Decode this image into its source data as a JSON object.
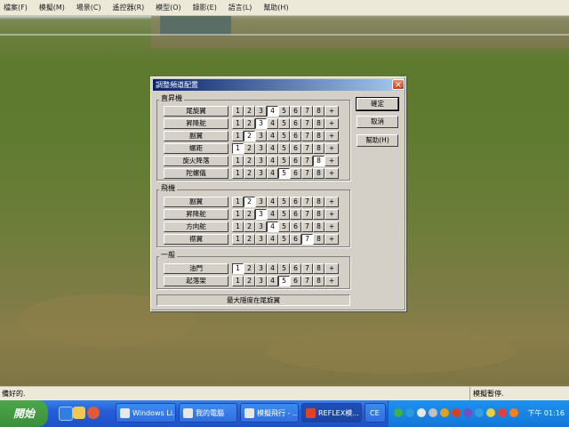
{
  "menu": [
    "檔案(F)",
    "模擬(M)",
    "場景(C)",
    "遙控器(R)",
    "模型(O)",
    "錄影(E)",
    "語言(L)",
    "幫助(H)"
  ],
  "status": {
    "left": "備好的.",
    "right": "模擬暫停."
  },
  "taskbar": {
    "start": "開始",
    "tasks": [
      "Windows Li...",
      "我的電腦",
      "模擬飛行 - ...",
      "REFLEX模...",
      "CE"
    ],
    "clock": "下午 01:16"
  },
  "dialog": {
    "title": "調整頻道配置",
    "close": "×",
    "buttons": {
      "ok": "確定",
      "cancel": "取消",
      "help": "幫助(H)"
    },
    "groups": [
      {
        "label": "直昇機",
        "rows": [
          {
            "name": "尾旋翼",
            "selected": 4
          },
          {
            "name": "昇降舵",
            "selected": 3
          },
          {
            "name": "副翼",
            "selected": 2
          },
          {
            "name": "螺距",
            "selected": 1
          },
          {
            "name": "旋火降落",
            "selected": 8
          },
          {
            "name": "陀螺儀",
            "selected": 5
          }
        ]
      },
      {
        "label": "飛機",
        "rows": [
          {
            "name": "副翼",
            "selected": 2
          },
          {
            "name": "昇降舵",
            "selected": 3
          },
          {
            "name": "方向舵",
            "selected": 4
          },
          {
            "name": "襟翼",
            "selected": 7
          }
        ]
      },
      {
        "label": "一般",
        "rows": [
          {
            "name": "油門",
            "selected": 1,
            "count": 8
          },
          {
            "name": "起落架",
            "selected": 5,
            "count": 8
          }
        ]
      }
    ],
    "numbers": [
      "1",
      "2",
      "3",
      "4",
      "5",
      "6",
      "7",
      "8"
    ],
    "plus": "+",
    "status_text": "最大隱度在尾旋翼"
  }
}
